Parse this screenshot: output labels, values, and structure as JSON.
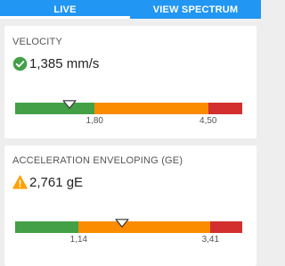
{
  "tabs": [
    {
      "label": "LIVE",
      "active": true
    },
    {
      "label": "VIEW SPECTRUM",
      "active": false
    }
  ],
  "colors": {
    "primary": "#2196f3",
    "good": "#43a047",
    "warning": "#fb8c00",
    "danger": "#d32f2f",
    "ok_icon": "#43a047",
    "warn_icon": "#ffa000"
  },
  "cards": [
    {
      "title": "VELOCITY",
      "status_icon": "check-circle-icon",
      "value": "1,385 mm/s",
      "gauge": {
        "level_fraction": 0.24,
        "thresholds": [
          "1,80",
          "4,50"
        ],
        "segment_fractions": [
          0.35,
          0.5,
          0.15
        ]
      }
    },
    {
      "title": "ACCELERATION ENVELOPING (GE)",
      "status_icon": "warning-triangle-icon",
      "value": "2,761 gE",
      "gauge": {
        "level_fraction": 0.47,
        "thresholds": [
          "1,14",
          "3,41"
        ],
        "segment_fractions": [
          0.28,
          0.58,
          0.14
        ]
      }
    }
  ]
}
